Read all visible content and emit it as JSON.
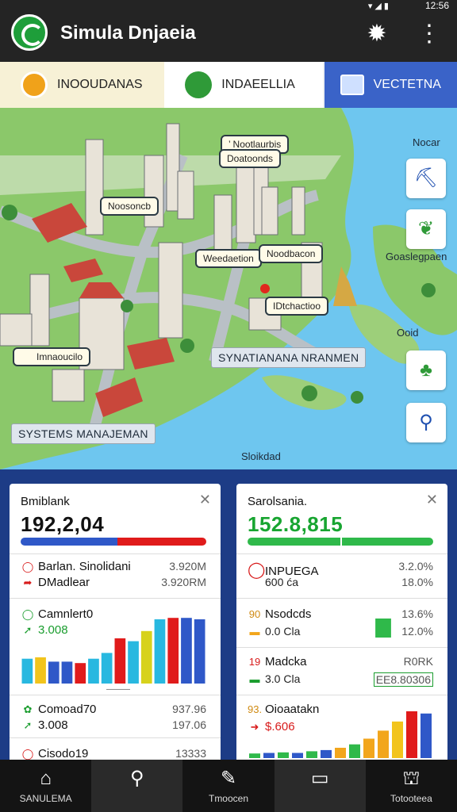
{
  "status_bar": {
    "time": "12:56",
    "signal_icon": "signal-wifi-battery-icons"
  },
  "app": {
    "title": "Simula Dnjaeia",
    "logo_icon": "app-logo-icon",
    "settings_icon": "gear-icon",
    "menu_icon": "more-vert-icon"
  },
  "tabs": [
    {
      "label": "INOOUDANAS",
      "icon": "folder-icon"
    },
    {
      "label": "INDAEELLIA",
      "icon": "globe-icon"
    },
    {
      "label": "VECTETNA",
      "icon": "building-icon"
    }
  ],
  "map": {
    "labels": {
      "top": "’ Nootlaurbis",
      "upper": "Doatoonds",
      "left": "Noosoncb",
      "mid_left": "Weedaetion",
      "mid_right": "Noodbacon",
      "marker": "IDtchactioo",
      "district": "Imnaoucilo"
    },
    "banners": {
      "center": "SYNATIANANA NRANMEN",
      "bottom_left": "SYSTEMS MANAJEMAN"
    },
    "plain": {
      "right_top": "Nocar",
      "right_mid": "Goaslegpaen",
      "right_low": "Ooid",
      "bottom": "Sloikdad"
    },
    "side_buttons": [
      "crane-tool-icon",
      "leaf-icon",
      "tree-icon",
      "pin-outline-icon"
    ]
  },
  "cards": {
    "left": {
      "title": "Bmiblank",
      "close_icon": "close-icon",
      "value": "192,2,04",
      "value_color": "#111111",
      "progress_split": [
        0.52,
        0.48
      ],
      "progress_colors": [
        "#2f58c8",
        "#e01b1b"
      ],
      "rows": [
        {
          "icon": "ring-red-icon",
          "label": "Barlan. Sinolidani",
          "value": "3.920M"
        },
        {
          "icon": "arrow-red-icon",
          "label": "DMadlear",
          "value": "3.920RM"
        }
      ],
      "chart_block": {
        "icon": "ring-green-icon",
        "label": "Camnlert0",
        "sub_icon": "arrow-up-icon",
        "sub_value": "3.008"
      },
      "chart_caption": "———",
      "footer_rows": [
        {
          "icon": "spark-green-icon",
          "label": "Comoad70",
          "value": "937.96"
        },
        {
          "icon": "arrow-up-icon",
          "label": "3.008",
          "value": "197.06"
        },
        {
          "icon": "ring-red-icon",
          "label": "Cisodo19",
          "value": "13333"
        }
      ]
    },
    "right": {
      "title": "Sarolsania.",
      "close_icon": "close-icon",
      "value": "152.8,815",
      "value_color": "#18a531",
      "progress_split": [
        0.5,
        0.5
      ],
      "progress_colors": [
        "#2fb94a",
        "#2fb94a"
      ],
      "rows": [
        {
          "icon": "ring-red-icon",
          "label": "INPUEGA",
          "sub": "600 ća",
          "value": "3.2.0%",
          "value2": "18.0%"
        },
        {
          "icon": "number-icon",
          "prefix": "90",
          "label": "Nsodcds",
          "sub": "0.0 Cla",
          "value": "13.6%",
          "value2": "12.0%"
        },
        {
          "prefix": "19",
          "label": "Madcka",
          "sub": "3.0 Cla",
          "value": "R0RK",
          "value2": "EE8.80306"
        },
        {
          "prefix": "93.",
          "label": "Oioaatakn",
          "sub": "$.606"
        }
      ]
    }
  },
  "chart_data": [
    {
      "type": "bar",
      "categories": [
        "1",
        "2",
        "3",
        "4",
        "5",
        "6",
        "7",
        "8",
        "9",
        "10",
        "11",
        "12",
        "13",
        "14"
      ],
      "values": [
        34,
        36,
        30,
        30,
        28,
        34,
        42,
        62,
        58,
        72,
        88,
        90,
        90,
        88
      ],
      "ylim": [
        0,
        100
      ],
      "colors": [
        "#28b8e0",
        "#f2c41c",
        "#2f58c8",
        "#2f58c8",
        "#e01b1b",
        "#28b8e0",
        "#28b8e0",
        "#e01b1b",
        "#28b8e0",
        "#d7d21c",
        "#28b8e0",
        "#e01b1b",
        "#2f58c8",
        "#2f58c8"
      ]
    },
    {
      "type": "bar",
      "categories": [
        "1",
        "2",
        "3",
        "4",
        "5",
        "6",
        "7",
        "8",
        "9",
        "10",
        "11",
        "12",
        "13"
      ],
      "values": [
        8,
        9,
        10,
        9,
        12,
        14,
        18,
        24,
        34,
        48,
        64,
        82,
        78
      ],
      "ylim": [
        0,
        100
      ],
      "colors": [
        "#2fb94a",
        "#2f58c8",
        "#2fb94a",
        "#2f58c8",
        "#2fb94a",
        "#2f58c8",
        "#f2a61c",
        "#2fb94a",
        "#f2a61c",
        "#f2a61c",
        "#f2c41c",
        "#e01b1b",
        "#2f58c8"
      ]
    },
    {
      "type": "bar",
      "categories": [
        "a"
      ],
      "values": [
        60
      ],
      "ylim": [
        0,
        100
      ],
      "colors": [
        "#2fb94a"
      ]
    }
  ],
  "bottom_nav": [
    {
      "label": "SANULEMA",
      "icon": "home-icon"
    },
    {
      "label": "",
      "icon": "search-icon"
    },
    {
      "label": "Tmoocen",
      "icon": "pencil-icon"
    },
    {
      "label": "",
      "icon": "window-icon"
    },
    {
      "label": "Totooteea",
      "icon": "station-icon"
    }
  ]
}
